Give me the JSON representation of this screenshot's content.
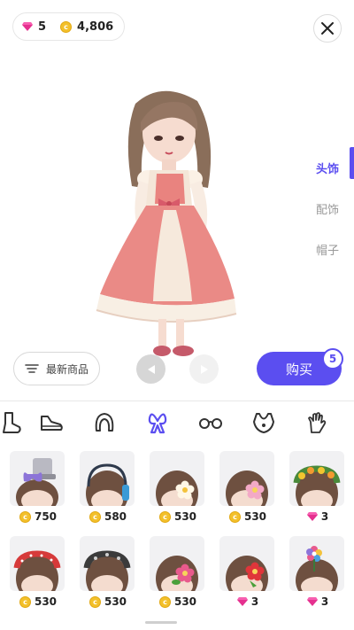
{
  "wallet": {
    "gems": "5",
    "coins": "4,806"
  },
  "side_tabs": [
    {
      "label": "头饰",
      "active": true
    },
    {
      "label": "配饰",
      "active": false
    },
    {
      "label": "帽子",
      "active": false
    }
  ],
  "filter_label": "最新商品",
  "buy": {
    "label": "购买",
    "count": "5"
  },
  "accent_color": "#5b4ef0",
  "categories": [
    "boot-icon",
    "sneaker-icon",
    "hair-icon",
    "bow-icon",
    "glasses-icon",
    "necklace-icon",
    "glove-icon"
  ],
  "items": [
    {
      "currency": "coin",
      "price": "750",
      "deco": "hat-bow"
    },
    {
      "currency": "coin",
      "price": "580",
      "deco": "headphone"
    },
    {
      "currency": "coin",
      "price": "530",
      "deco": "flower-white"
    },
    {
      "currency": "coin",
      "price": "530",
      "deco": "flower-pink"
    },
    {
      "currency": "gem",
      "price": "3",
      "deco": "wreath"
    },
    {
      "currency": "coin",
      "price": "530",
      "deco": "red-band"
    },
    {
      "currency": "coin",
      "price": "530",
      "deco": "black-band"
    },
    {
      "currency": "coin",
      "price": "530",
      "deco": "flower-pink2"
    },
    {
      "currency": "gem",
      "price": "3",
      "deco": "flower-red"
    },
    {
      "currency": "gem",
      "price": "3",
      "deco": "flower-pin"
    }
  ]
}
